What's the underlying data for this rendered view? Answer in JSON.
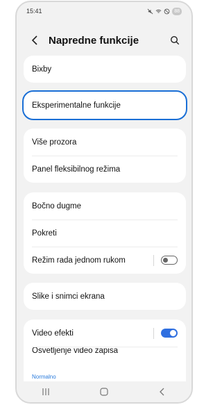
{
  "status_bar": {
    "time": "15:41",
    "battery": "88"
  },
  "header": {
    "title": "Napredne funkcije"
  },
  "groups": [
    {
      "items": [
        {
          "label": "Bixby"
        }
      ]
    },
    {
      "items": [
        {
          "label": "Eksperimentalne funkcije",
          "highlighted": true
        }
      ]
    },
    {
      "items": [
        {
          "label": "Više prozora"
        },
        {
          "label": "Panel fleksibilnog režima"
        }
      ]
    },
    {
      "items": [
        {
          "label": "Bočno dugme"
        },
        {
          "label": "Pokreti"
        },
        {
          "label": "Režim rada jednom rukom",
          "toggle": "off"
        }
      ]
    },
    {
      "items": [
        {
          "label": "Slike i snimci ekrana"
        }
      ]
    },
    {
      "items": [
        {
          "label": "Video efekti",
          "toggle": "on"
        },
        {
          "label": "Osvetljenje video zapisa",
          "subtext": "Normalno"
        }
      ]
    }
  ],
  "icons": {
    "back": "chevron-left-icon",
    "search": "search-icon",
    "nav_recents": "recents-icon",
    "nav_home": "home-icon",
    "nav_back": "back-icon"
  },
  "colors": {
    "accent": "#2f6fe0",
    "highlight": "#1a6fd6",
    "background": "#f2f2f2"
  }
}
